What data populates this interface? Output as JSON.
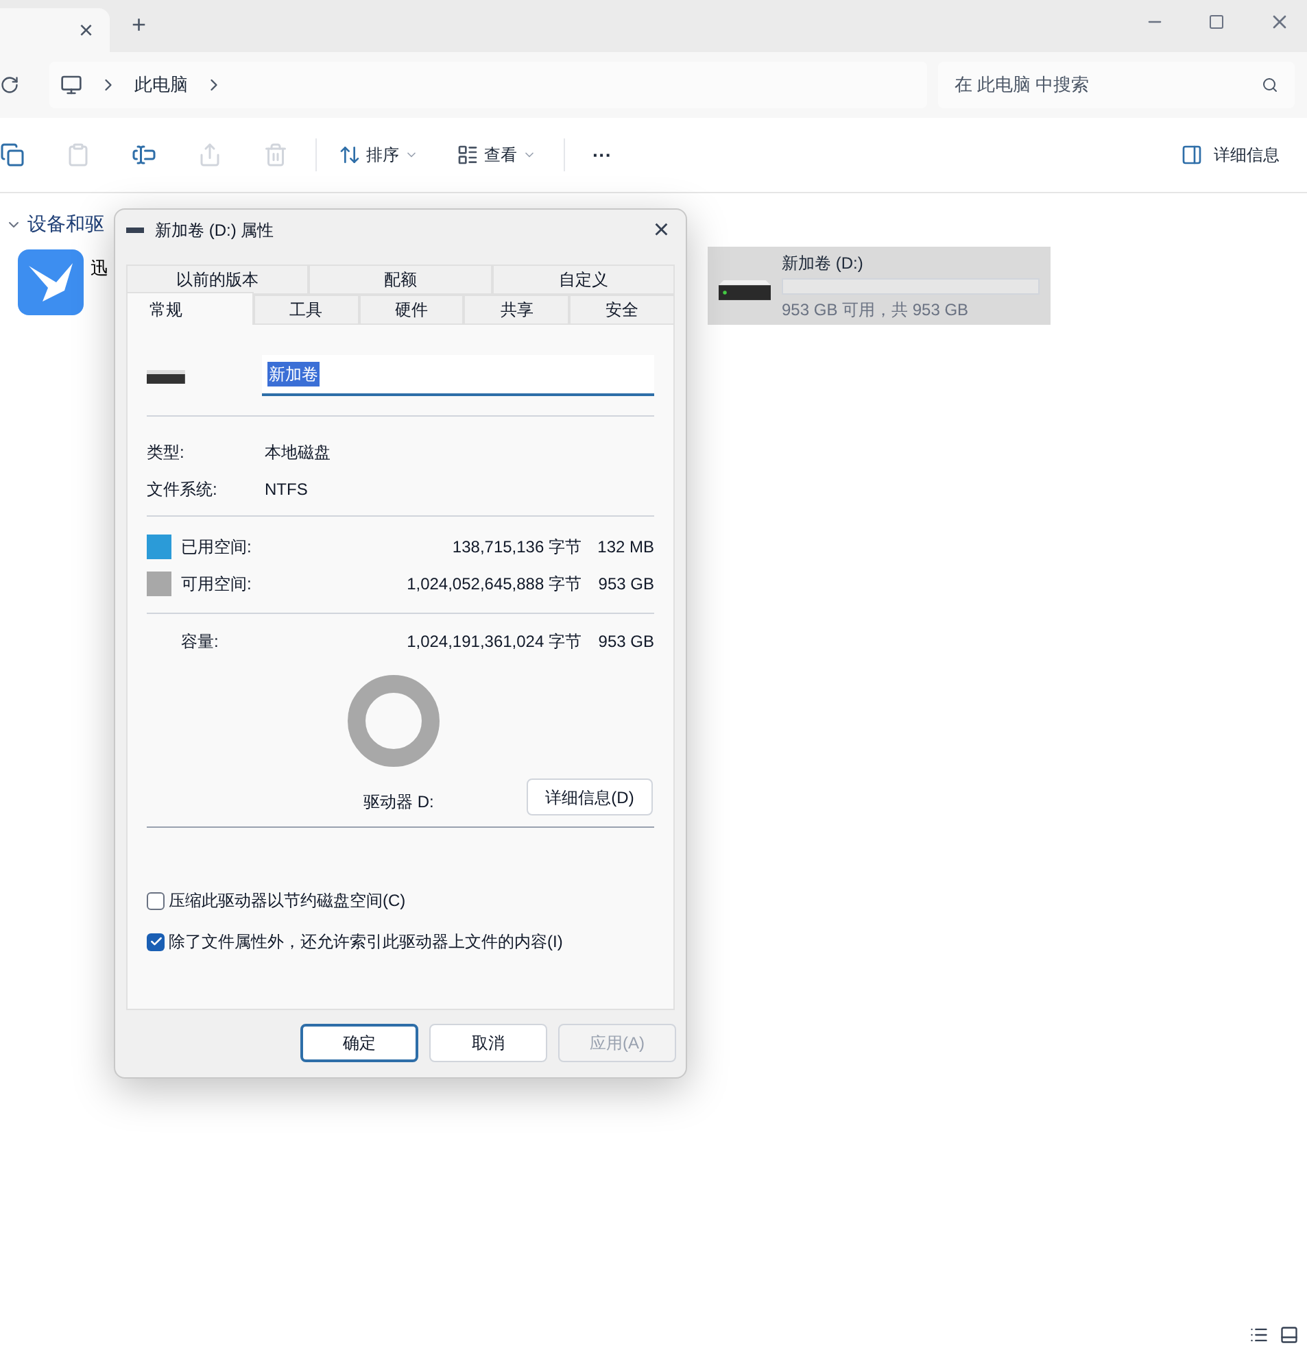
{
  "explorer": {
    "tab_close": "×",
    "new_tab": "+",
    "breadcrumb": [
      "此电脑"
    ],
    "search": {
      "placeholder": "在 此电脑 中搜索"
    },
    "toolbar": [
      {
        "kind": "copy",
        "disabled": false
      },
      {
        "kind": "paste",
        "disabled": true
      },
      {
        "kind": "rename",
        "disabled": false
      },
      {
        "kind": "share",
        "disabled": true
      },
      {
        "kind": "delete",
        "disabled": true
      }
    ],
    "sort_button": "排序",
    "view_button": "查看",
    "more_button": "···",
    "details_button": "详细信息",
    "section_title": "设备和驱",
    "app_label": "迅",
    "drive": {
      "name": "新加卷 (D:)",
      "level": 0,
      "reading": "953 GB 可用，共 953 GB",
      "selected": true
    }
  },
  "dialog": {
    "title": "新加卷 (D:) 属性",
    "close": "×",
    "tabs_back": [
      {
        "label": "以前的版本",
        "selected": false
      },
      {
        "label": "配额",
        "selected": false
      },
      {
        "label": "自定义",
        "selected": false
      }
    ],
    "tabs_front": [
      {
        "label": "常规",
        "selected": true
      },
      {
        "label": "工具",
        "selected": false
      },
      {
        "label": "硬件",
        "selected": false
      },
      {
        "label": "共享",
        "selected": false
      },
      {
        "label": "安全",
        "selected": false
      }
    ],
    "volume_name": "新加卷",
    "info": [
      {
        "label": "类型:",
        "value": "本地磁盘"
      },
      {
        "label": "文件系统:",
        "value": "NTFS"
      }
    ],
    "space": [
      {
        "label": "已用空间:",
        "bytes": "138,715,136 字节",
        "size": "132 MB",
        "color": "#2b9bd8"
      },
      {
        "label": "可用空间:",
        "bytes": "1,024,052,645,888 字节",
        "size": "953 GB",
        "color": "#a8a8a8"
      }
    ],
    "capacity": {
      "label": "容量:",
      "bytes": "1,024,191,361,024 字节",
      "size": "953 GB"
    },
    "drive_label": "驱动器 D:",
    "details_button": "详细信息(D)",
    "options": [
      {
        "label": "压缩此驱动器以节约磁盘空间(C)",
        "checked": false
      },
      {
        "label": "除了文件属性外，还允许索引此驱动器上文件的内容(I)",
        "checked": true
      }
    ],
    "buttons": [
      {
        "label": "确定",
        "kind": "default",
        "disabled": false
      },
      {
        "label": "取消",
        "kind": "normal",
        "disabled": false
      },
      {
        "label": "应用(A)",
        "kind": "normal",
        "disabled": true
      }
    ]
  }
}
